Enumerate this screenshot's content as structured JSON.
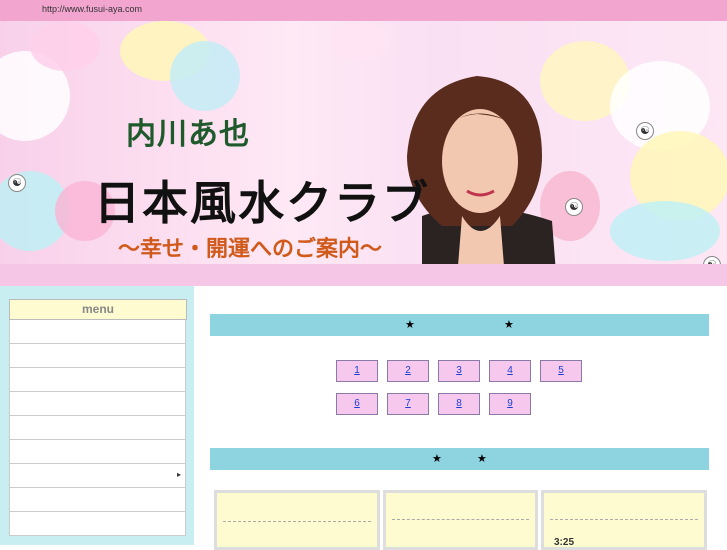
{
  "topbar": {
    "url": "http://www.fusui-aya.com"
  },
  "header": {
    "name": "内川あ也",
    "club": "日本風水クラブ",
    "tagline": "～幸せ・開運へのご案内～"
  },
  "sidebar": {
    "menu_title": "menu",
    "items": [
      "",
      "",
      "",
      "",
      "",
      "",
      "",
      "",
      "",
      ""
    ]
  },
  "main": {
    "section1": {
      "left_star": "★",
      "right_star": "★"
    },
    "buttons_row1": [
      "1",
      "2",
      "3",
      "4",
      "5"
    ],
    "buttons_row2": [
      "6",
      "7",
      "8",
      "9"
    ],
    "section2": {
      "left_star": "★",
      "right_star": "★"
    },
    "card3_text": "3:25"
  },
  "colors": {
    "topbar": "#f2a6cf",
    "sidebar": "#c8eef2",
    "section_bar": "#8dd3e0",
    "button": "#f7c8ee",
    "card": "#fffbd0"
  }
}
